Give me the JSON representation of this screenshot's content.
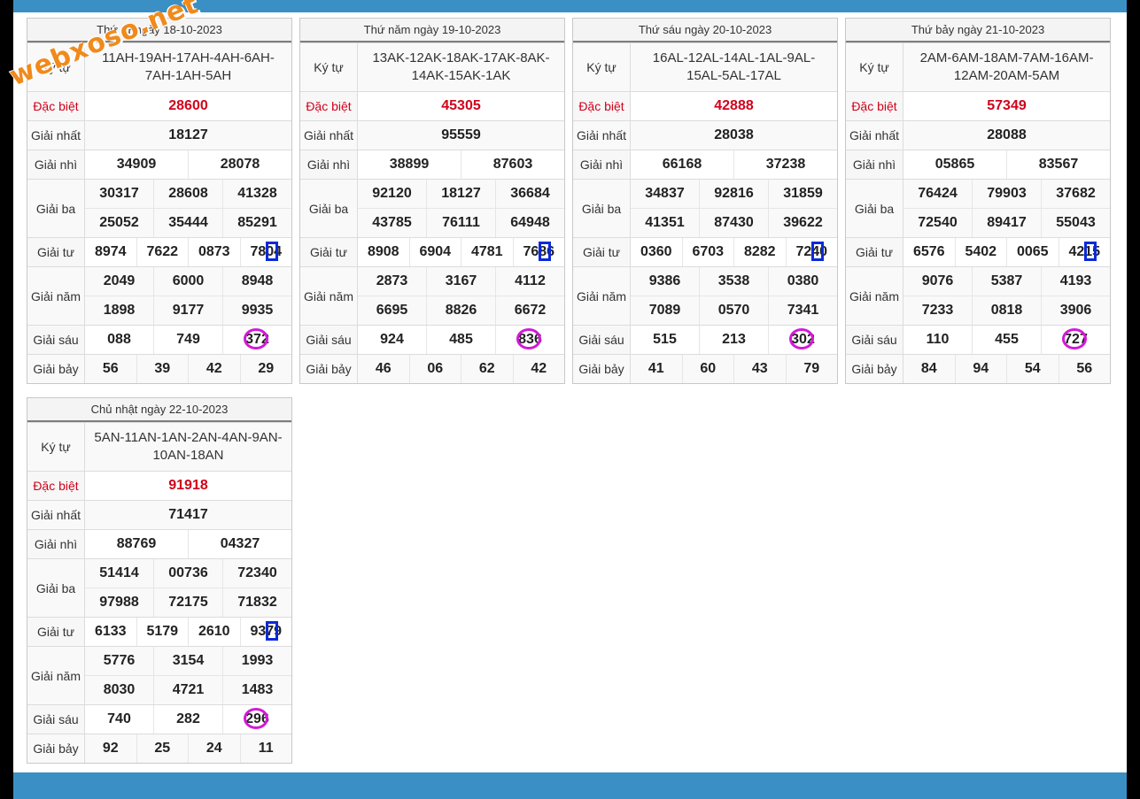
{
  "watermark": "webxoso.net",
  "labels": {
    "kytu": "Ký tự",
    "db": "Đặc biệt",
    "g1": "Giải nhất",
    "g2": "Giải nhì",
    "g3": "Giải ba",
    "g4": "Giải tư",
    "g5": "Giải năm",
    "g6": "Giải sáu",
    "g7": "Giải bảy"
  },
  "cards": [
    {
      "title": "Thứ tư ngày 18-10-2023",
      "kytu": "11AH-19AH-17AH-4AH-6AH-7AH-1AH-5AH",
      "db": "28600",
      "g1": "18127",
      "g2": [
        "34909",
        "28078"
      ],
      "g3": [
        "30317",
        "28608",
        "41328",
        "25052",
        "35444",
        "85291"
      ],
      "g4": [
        "8974",
        "7622",
        "0873",
        "7804"
      ],
      "g5": [
        "2049",
        "6000",
        "8948",
        "1898",
        "9177",
        "9935"
      ],
      "g6": [
        "088",
        "749",
        "372"
      ],
      "g7": [
        "56",
        "39",
        "42",
        "29"
      ]
    },
    {
      "title": "Thứ năm ngày 19-10-2023",
      "kytu": "13AK-12AK-18AK-17AK-8AK-14AK-15AK-1AK",
      "db": "45305",
      "g1": "95559",
      "g2": [
        "38899",
        "87603"
      ],
      "g3": [
        "92120",
        "18127",
        "36684",
        "43785",
        "76111",
        "64948"
      ],
      "g4": [
        "8908",
        "6904",
        "4781",
        "7686"
      ],
      "g5": [
        "2873",
        "3167",
        "4112",
        "6695",
        "8826",
        "6672"
      ],
      "g6": [
        "924",
        "485",
        "836"
      ],
      "g7": [
        "46",
        "06",
        "62",
        "42"
      ]
    },
    {
      "title": "Thứ sáu ngày 20-10-2023",
      "kytu": "16AL-12AL-14AL-1AL-9AL-15AL-5AL-17AL",
      "db": "42888",
      "g1": "28038",
      "g2": [
        "66168",
        "37238"
      ],
      "g3": [
        "34837",
        "92816",
        "31859",
        "41351",
        "87430",
        "39622"
      ],
      "g4": [
        "0360",
        "6703",
        "8282",
        "7240"
      ],
      "g5": [
        "9386",
        "3538",
        "0380",
        "7089",
        "0570",
        "7341"
      ],
      "g6": [
        "515",
        "213",
        "302"
      ],
      "g7": [
        "41",
        "60",
        "43",
        "79"
      ]
    },
    {
      "title": "Thứ bảy ngày 21-10-2023",
      "kytu": "2AM-6AM-18AM-7AM-16AM-12AM-20AM-5AM",
      "db": "57349",
      "g1": "28088",
      "g2": [
        "05865",
        "83567"
      ],
      "g3": [
        "76424",
        "79903",
        "37682",
        "72540",
        "89417",
        "55043"
      ],
      "g4": [
        "6576",
        "5402",
        "0065",
        "4215"
      ],
      "g5": [
        "9076",
        "5387",
        "4193",
        "7233",
        "0818",
        "3906"
      ],
      "g6": [
        "110",
        "455",
        "727"
      ],
      "g7": [
        "84",
        "94",
        "54",
        "56"
      ]
    },
    {
      "title": "Chủ nhật ngày 22-10-2023",
      "kytu": "5AN-11AN-1AN-2AN-4AN-9AN-10AN-18AN",
      "db": "91918",
      "g1": "71417",
      "g2": [
        "88769",
        "04327"
      ],
      "g3": [
        "51414",
        "00736",
        "72340",
        "97988",
        "72175",
        "71832"
      ],
      "g4": [
        "6133",
        "5179",
        "2610",
        "9379"
      ],
      "g5": [
        "5776",
        "3154",
        "1993",
        "8030",
        "4721",
        "1483"
      ],
      "g6": [
        "740",
        "282",
        "296"
      ],
      "g7": [
        "92",
        "25",
        "24",
        "11"
      ]
    }
  ]
}
